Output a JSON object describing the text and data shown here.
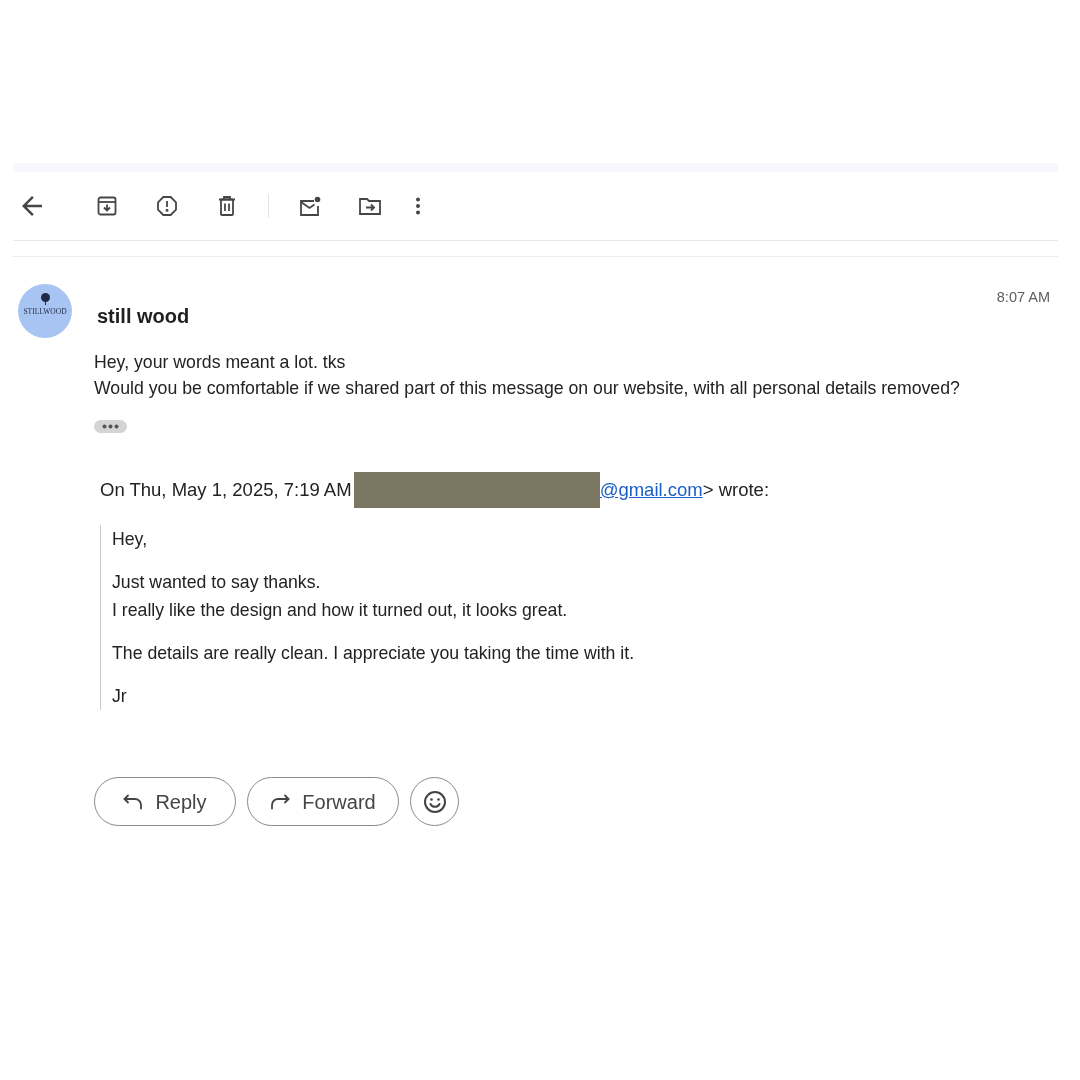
{
  "message": {
    "sender": {
      "name": "still wood",
      "logo_text": "STILLWOOD"
    },
    "time": "8:07 AM",
    "body": [
      "Hey, your words meant a lot. tks",
      "Would you be comfortable if we shared part of this message on our website, with all personal details removed?"
    ],
    "quoted": {
      "attribution": {
        "prefix": "On Thu, May 1, 2025, 7:19 AM",
        "redacted": true,
        "link": "@gmail.com",
        "suffix": "> wrote:"
      },
      "paragraphs": [
        [
          "Hey,"
        ],
        [
          "Just wanted to say thanks.",
          "I really like the design and how it turned out, it looks great."
        ],
        [
          "The details are really clean. I appreciate you taking the time with it."
        ],
        [
          "Jr"
        ]
      ]
    }
  },
  "actions": [
    {
      "kind": "reply",
      "label": "Reply"
    },
    {
      "kind": "forward",
      "label": "Forward"
    },
    {
      "kind": "emoji"
    }
  ]
}
